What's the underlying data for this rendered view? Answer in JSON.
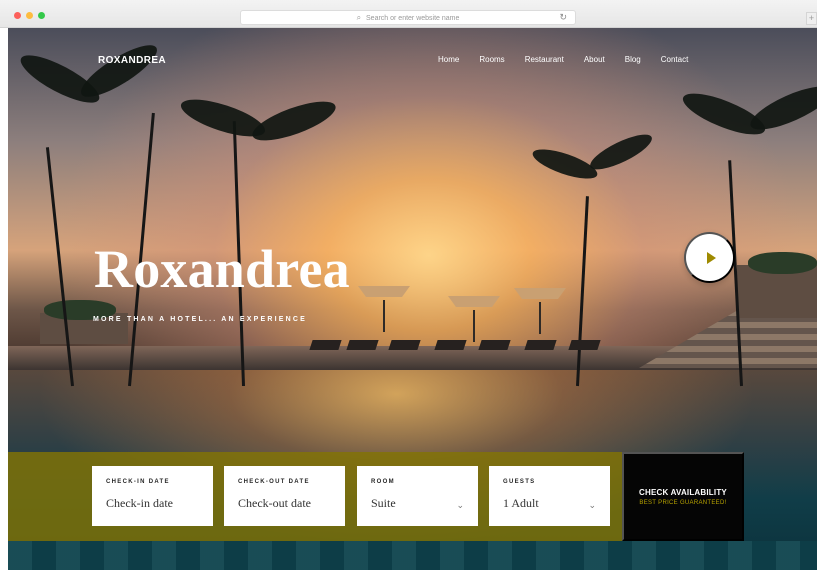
{
  "browser": {
    "address_placeholder": "Search or enter website name",
    "new_tab_symbol": "+"
  },
  "header": {
    "logo": "ROXANDREA",
    "nav": [
      "Home",
      "Rooms",
      "Restaurant",
      "About",
      "Blog",
      "Contact"
    ]
  },
  "hero": {
    "title": "Roxandrea",
    "tagline": "MORE THAN A HOTEL... AN EXPERIENCE",
    "play_icon": "play-icon"
  },
  "booking": {
    "fields": [
      {
        "label": "CHECK-IN DATE",
        "value": "Check-in date",
        "has_dropdown": false
      },
      {
        "label": "CHECK-OUT DATE",
        "value": "Check-out date",
        "has_dropdown": false
      },
      {
        "label": "ROOM",
        "value": "Suite",
        "has_dropdown": true
      },
      {
        "label": "GUESTS",
        "value": "1 Adult",
        "has_dropdown": true
      }
    ],
    "button": {
      "label": "CHECK AVAILABILITY",
      "subtext": "BEST PRICE GUARANTEED!"
    }
  },
  "colors": {
    "accent": "#9E8A00",
    "booking_overlay": "#827405",
    "button_background": "#050505",
    "text_light": "#FFFFFF"
  }
}
